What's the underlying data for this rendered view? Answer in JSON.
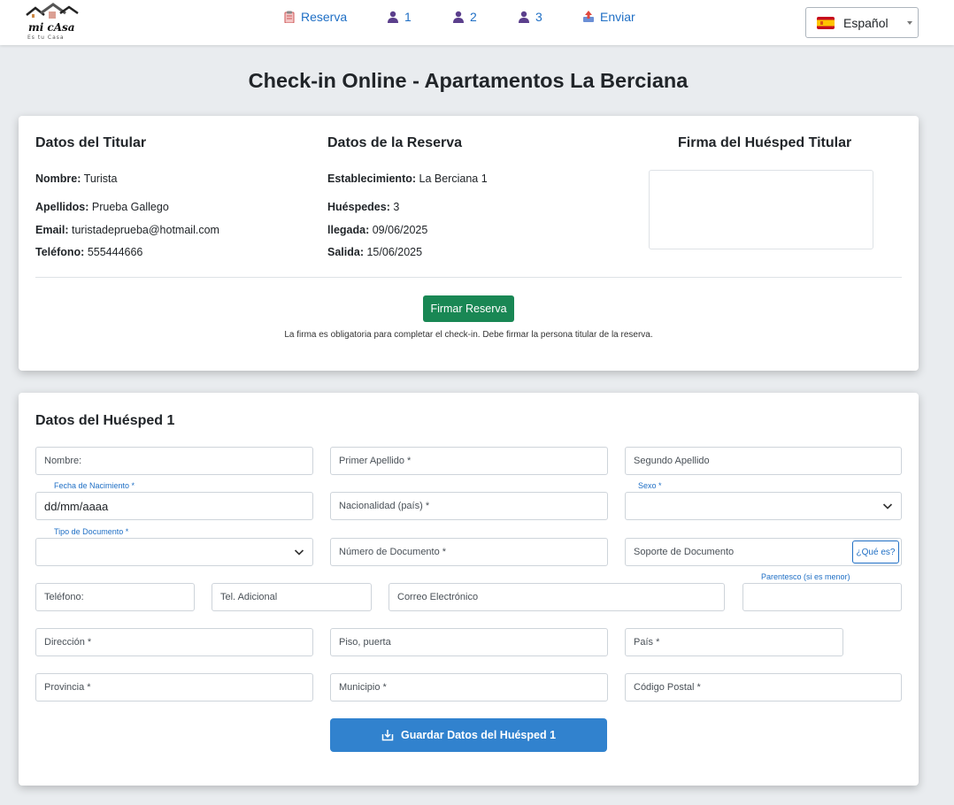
{
  "nav": {
    "logo_text": "mi cAsa",
    "logo_tagline": "Es tu Casa",
    "links": [
      {
        "label": "Reserva",
        "icon": "clipboard-icon"
      },
      {
        "label": "1",
        "icon": "user-icon"
      },
      {
        "label": "2",
        "icon": "user-icon"
      },
      {
        "label": "3",
        "icon": "user-icon"
      },
      {
        "label": "Enviar",
        "icon": "send-icon"
      }
    ],
    "language": "Español"
  },
  "page_title": "Check-in Online - Apartamentos La Berciana",
  "holder": {
    "title": "Datos del Titular",
    "nombre_label": "Nombre:",
    "nombre": "Turista",
    "apellidos_label": "Apellidos:",
    "apellidos": "Prueba Gallego",
    "email_label": "Email:",
    "email": "turistadeprueba@hotmail.com",
    "telefono_label": "Teléfono:",
    "telefono": "555444666"
  },
  "reservation": {
    "title": "Datos de la Reserva",
    "establecimiento_label": "Establecimiento:",
    "establecimiento": "La Berciana 1",
    "huespedes_label": "Huéspedes:",
    "huespedes": "3",
    "llegada_label": "llegada:",
    "llegada": "09/06/2025",
    "salida_label": "Salida:",
    "salida": "15/06/2025"
  },
  "signature": {
    "title": "Firma del Huésped Titular",
    "button": "Firmar Reserva",
    "note": "La firma es obligatoria para completar el check-in. Debe firmar la persona titular de la reserva."
  },
  "guest_form": {
    "title": "Datos del Huésped 1",
    "nombre": "Nombre:",
    "primer_apellido": "Primer Apellido *",
    "segundo_apellido": "Segundo Apellido",
    "fecha_label": "Fecha de Nacimiento *",
    "fecha_value": "dd/mm/aaaa",
    "nacionalidad": "Nacionalidad (país) *",
    "sexo_label": "Sexo *",
    "tipo_doc_label": "Tipo de Documento *",
    "numero_doc": "Número de Documento *",
    "soporte_doc": "Soporte de Documento",
    "que_es": "¿Qué es?",
    "telefono": "Teléfono:",
    "tel_adicional": "Tel. Adicional",
    "correo": "Correo Electrónico",
    "parentesco_label": "Parentesco (si es menor)",
    "direccion": "Dirección *",
    "piso": "Piso, puerta",
    "pais": "País *",
    "provincia": "Provincia *",
    "municipio": "Municipio *",
    "codigo_postal": "Código Postal *",
    "save_button": "Guardar Datos del Huésped 1"
  },
  "colors": {
    "link": "#1f6fc5",
    "success": "#198754",
    "primary": "#3182ce"
  }
}
